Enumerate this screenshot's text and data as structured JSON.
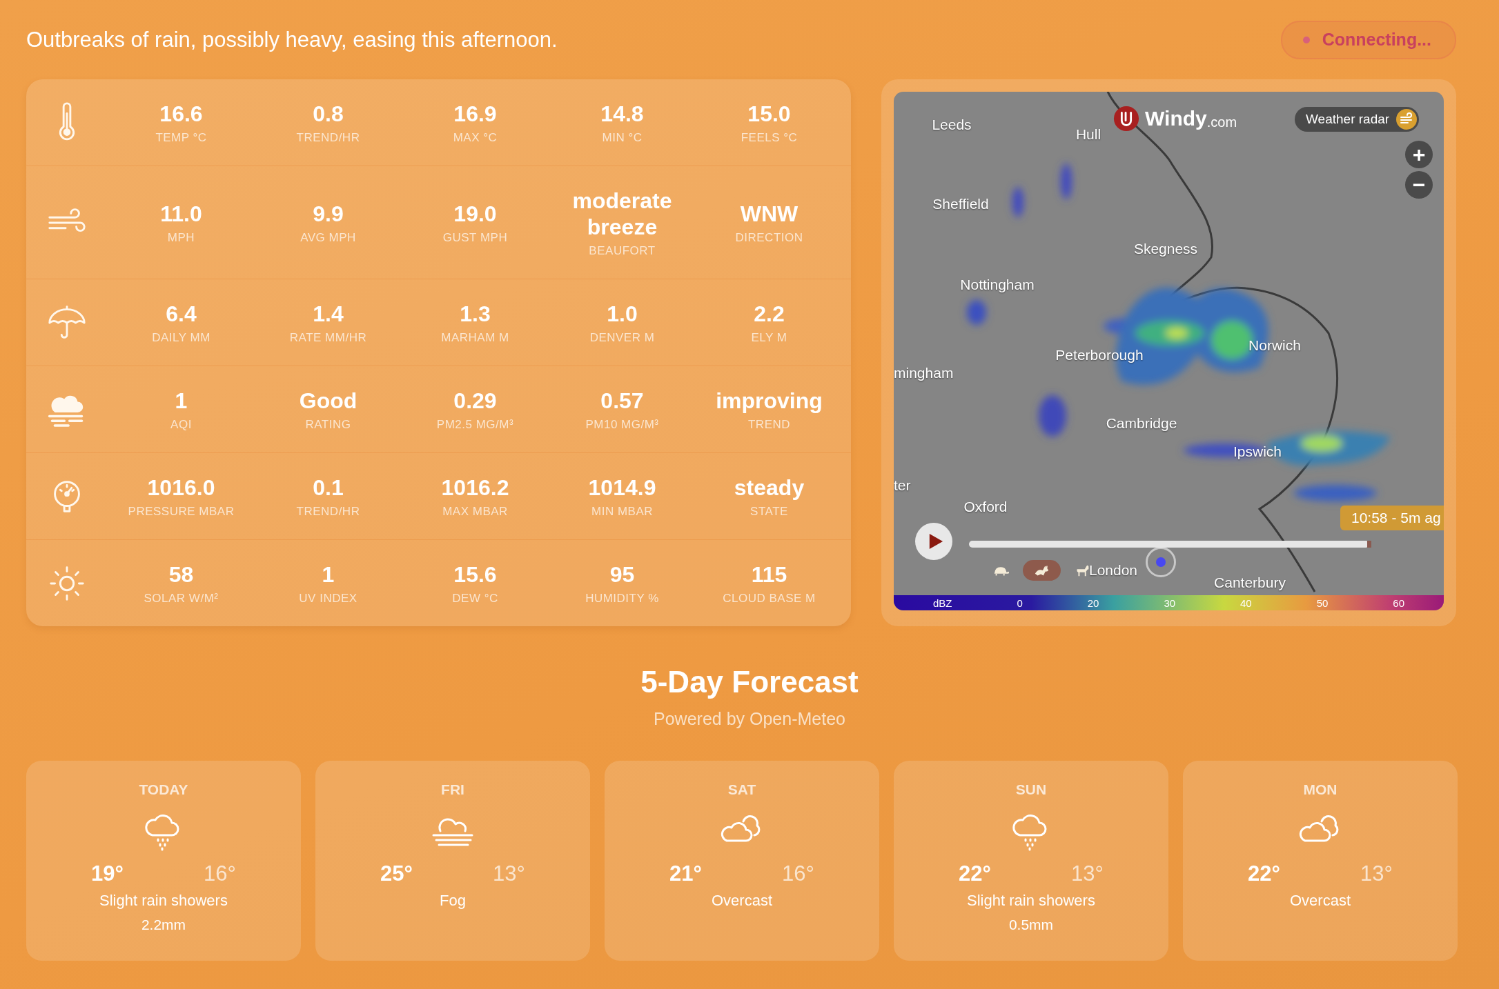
{
  "header": {
    "summary": "Outbreaks of rain, possibly heavy, easing this afternoon.",
    "connection": {
      "label": "Connecting...",
      "kind": "connecting"
    }
  },
  "stats": [
    {
      "kind": "temperature",
      "cells": [
        {
          "value": "16.6",
          "label": "TEMP °C"
        },
        {
          "value": "0.8",
          "label": "TREND/HR"
        },
        {
          "value": "16.9",
          "label": "MAX °C"
        },
        {
          "value": "14.8",
          "label": "MIN °C"
        },
        {
          "value": "15.0",
          "label": "FEELS °C"
        }
      ]
    },
    {
      "kind": "wind",
      "cells": [
        {
          "value": "11.0",
          "label": "MPH"
        },
        {
          "value": "9.9",
          "label": "AVG MPH"
        },
        {
          "value": "19.0",
          "label": "GUST MPH"
        },
        {
          "value": "moderate breeze",
          "label": "BEAUFORT"
        },
        {
          "value": "WNW",
          "label": "DIRECTION"
        }
      ]
    },
    {
      "kind": "rain",
      "cells": [
        {
          "value": "6.4",
          "label": "DAILY MM"
        },
        {
          "value": "1.4",
          "label": "RATE MM/HR"
        },
        {
          "value": "1.3",
          "label": "MARHAM M"
        },
        {
          "value": "1.0",
          "label": "DENVER M"
        },
        {
          "value": "2.2",
          "label": "ELY M"
        }
      ]
    },
    {
      "kind": "air",
      "cells": [
        {
          "value": "1",
          "label": "AQI"
        },
        {
          "value": "Good",
          "label": "RATING"
        },
        {
          "value": "0.29",
          "label": "PM2.5 MG/M³"
        },
        {
          "value": "0.57",
          "label": "PM10 MG/M³"
        },
        {
          "value": "improving",
          "label": "TREND"
        }
      ]
    },
    {
      "kind": "pressure",
      "cells": [
        {
          "value": "1016.0",
          "label": "PRESSURE MBAR"
        },
        {
          "value": "0.1",
          "label": "TREND/HR"
        },
        {
          "value": "1016.2",
          "label": "MAX MBAR"
        },
        {
          "value": "1014.9",
          "label": "MIN MBAR"
        },
        {
          "value": "steady",
          "label": "STATE"
        }
      ]
    },
    {
      "kind": "solar",
      "cells": [
        {
          "value": "58",
          "label": "SOLAR W/M²"
        },
        {
          "value": "1",
          "label": "UV INDEX"
        },
        {
          "value": "15.6",
          "label": "DEW °C"
        },
        {
          "value": "95",
          "label": "HUMIDITY %"
        },
        {
          "value": "115",
          "label": "CLOUD BASE M"
        }
      ]
    }
  ],
  "map": {
    "brand": "Windy",
    "brand_suffix": ".com",
    "layer_button": "Weather radar",
    "zoom_in": "+",
    "zoom_out": "−",
    "places": [
      "Leeds",
      "Hull",
      "Sheffield",
      "Skegness",
      "Nottingham",
      "Peterborough",
      "Norwich",
      "mingham",
      "Cambridge",
      "Ipswich",
      "ter",
      "Oxford",
      "London",
      "Canterbury"
    ],
    "timeline": {
      "level": 1,
      "tooltip": "10:58 - 5m ag"
    },
    "speeds": [
      {
        "kind": "slow",
        "selected": false
      },
      {
        "kind": "medium",
        "selected": true
      },
      {
        "kind": "fast",
        "selected": false
      }
    ],
    "legend": {
      "unit": "dBZ",
      "ticks": [
        "0",
        "20",
        "30",
        "40",
        "50",
        "60"
      ]
    }
  },
  "forecast": {
    "title": "5-Day Forecast",
    "subtitle": "Powered by Open-Meteo",
    "days": [
      {
        "day": "TODAY",
        "kind": "rain-showers",
        "high": "19°",
        "low": "16°",
        "summary": "Slight rain showers",
        "precip": "2.2mm"
      },
      {
        "day": "FRI",
        "kind": "fog",
        "high": "25°",
        "low": "13°",
        "summary": "Fog"
      },
      {
        "day": "SAT",
        "kind": "overcast",
        "high": "21°",
        "low": "16°",
        "summary": "Overcast"
      },
      {
        "day": "SUN",
        "kind": "rain-showers",
        "high": "22°",
        "low": "13°",
        "summary": "Slight rain showers",
        "precip": "0.5mm"
      },
      {
        "day": "MON",
        "kind": "overcast",
        "high": "22°",
        "low": "13°",
        "summary": "Overcast"
      }
    ]
  }
}
